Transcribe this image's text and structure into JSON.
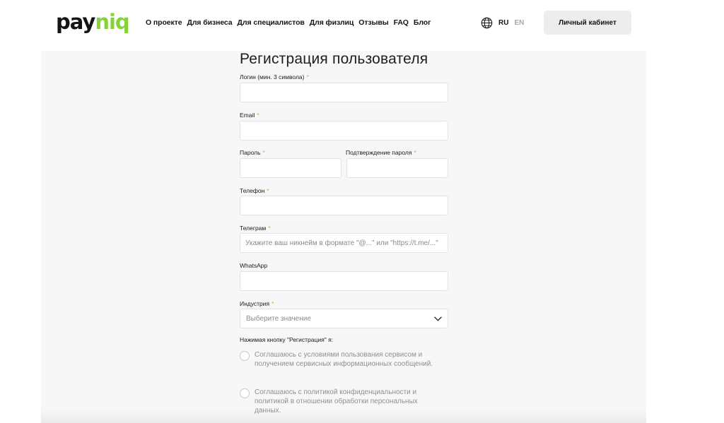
{
  "header": {
    "logo": {
      "part1": "pay",
      "part2": "niq"
    },
    "nav": [
      "О проекте",
      "Для бизнеса",
      "Для специалистов",
      "Для физлиц",
      "Отзывы",
      "FAQ",
      "Блог"
    ],
    "languages": {
      "active": "RU",
      "inactive": "EN"
    },
    "cabinet_label": "Личный кабинет"
  },
  "form": {
    "title": "Регистрация пользователя",
    "required_mark": "*",
    "login": {
      "label": "Логин (мин. 3 символа)",
      "value": "",
      "placeholder": ""
    },
    "email": {
      "label": "Email",
      "value": "",
      "placeholder": ""
    },
    "password": {
      "label": "Пароль",
      "value": ""
    },
    "password_confirm": {
      "label": "Подтверждение пароля",
      "value": ""
    },
    "phone": {
      "label": "Телефон",
      "value": ""
    },
    "telegram": {
      "label": "Телеграм",
      "placeholder": "Укажите ваш никнейм в формате \"@...\" или \"https://t.me/...\""
    },
    "whatsapp": {
      "label": "WhatsApp",
      "value": ""
    },
    "industry": {
      "label": "Индустрия",
      "placeholder": "Выберите значение"
    },
    "agree_title": "Нажимая кнопку \"Регистрация\" я:",
    "agreements": [
      "Соглашаюсь с условиями пользования сервисом и получением сервисных информационных сообщений.",
      "Соглашаюсь с политикой конфиденциальности и политикой в отношении обработки персональных данных."
    ]
  },
  "colors": {
    "accent": "#86d23a",
    "panel": "#f7f7f7",
    "button": "#ededed"
  }
}
